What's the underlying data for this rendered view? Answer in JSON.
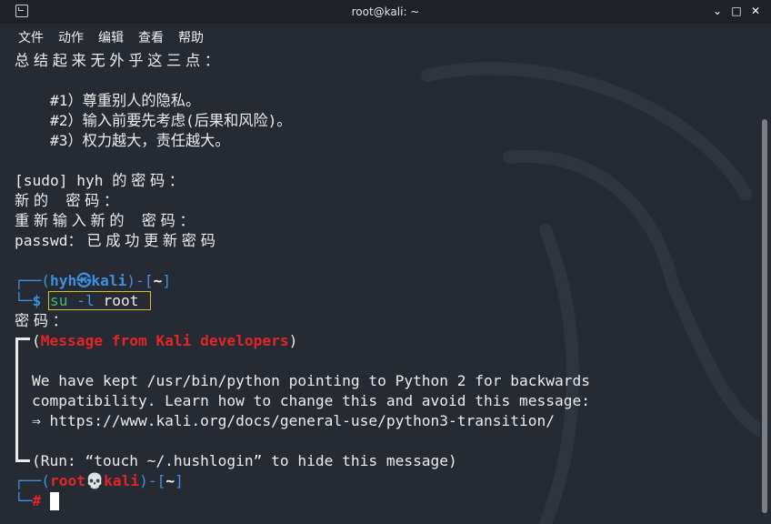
{
  "window": {
    "title": "root@kali: ~",
    "icon": "terminal-icon",
    "controls": {
      "minimize": "⌄",
      "maximize": "□",
      "close": "✕"
    }
  },
  "menu": [
    "文件",
    "动作",
    "编辑",
    "查看",
    "帮助"
  ],
  "terminal": {
    "lecture_intro": "总结起来无外乎这三点：",
    "lecture_items": [
      "#1）尊重别人的隐私。",
      "#2）输入前要先考虑(后果和风险)。",
      "#3）权力越大，责任越大。"
    ],
    "sudo_prompt_prefix": "[sudo] hyh ",
    "sudo_prompt_cjk": "的密码：",
    "new_password": "新的 密码：",
    "retype_password": "重新输入新的 密码：",
    "passwd_prefix": "passwd",
    "passwd_result": "：已成功更新密码",
    "prompt1": {
      "open": "┌──(",
      "user": "hyh",
      "host_sep": "㉿",
      "host": "kali",
      "close": ")-[",
      "dir": "~",
      "end": "]",
      "corner": "└─",
      "symbol": "$"
    },
    "command": {
      "cmd": "su",
      "flag": "-l",
      "arg": "root"
    },
    "password_prompt": "密码：",
    "message_title": "Message from Kali developers",
    "message_lines": [
      "We have kept /usr/bin/python pointing to Python 2 for backwards",
      "compatibility. Learn how to change this and avoid this message:",
      "⇒ https://www.kali.org/docs/general-use/python3-transition/"
    ],
    "run_hint": "(Run: “touch ~/.hushlogin” to hide this message)",
    "prompt2": {
      "open": "┌──(",
      "user": "root",
      "host_sep": "💀",
      "host": "kali",
      "close": ")-[",
      "dir": "~",
      "end": "]",
      "corner": "└─",
      "symbol": "#"
    }
  },
  "colors": {
    "background": "#262b33",
    "prompt_blue": "#3d8fe0",
    "root_red": "#e02525",
    "command_green": "#3fbf6a",
    "highlight_box": "#d8c21a"
  }
}
